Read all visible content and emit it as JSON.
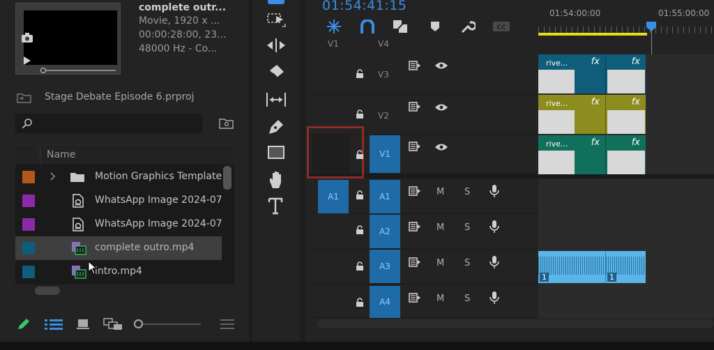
{
  "preview": {
    "name": "complete outr...",
    "line1": "Movie, 1920 x ...",
    "line2": "00:00:28:00, 23...",
    "line3": "48000 Hz - Co..."
  },
  "project": {
    "name": "Stage Debate Episode 6.prproj",
    "search_placeholder": "",
    "column_name": "Name",
    "items": [
      {
        "label": "Motion Graphics Template",
        "color": "#b5561c",
        "type": "folder"
      },
      {
        "label": "WhatsApp Image 2024-07",
        "color": "#8b2aa8",
        "type": "image"
      },
      {
        "label": "WhatsApp Image 2024-07",
        "color": "#8b2aa8",
        "type": "image"
      },
      {
        "label": "complete outro.mp4",
        "color": "#0e5d7a",
        "type": "video"
      },
      {
        "label": "intro.mp4",
        "color": "#0e5d7a",
        "type": "video"
      }
    ]
  },
  "timeline": {
    "timecode": "01:54:41:15",
    "ruler": [
      "01:54:00:00",
      "01:55:00:00"
    ],
    "src_v": "V1",
    "src_v4": "V4",
    "video_tracks": [
      {
        "label": "V3",
        "src": ""
      },
      {
        "label": "V2",
        "src": ""
      },
      {
        "label": "V1",
        "src": "V1"
      }
    ],
    "audio_tracks": [
      {
        "label": "A1",
        "src": "A1"
      },
      {
        "label": "A2",
        "src": ""
      },
      {
        "label": "A3",
        "src": ""
      },
      {
        "label": "A4",
        "src": ""
      }
    ],
    "m": "M",
    "s": "S",
    "clip_name": "rive...",
    "fx": "fx",
    "audio_clip_num": "1"
  },
  "colors": {
    "accent": "#3a8ee6",
    "v3_clip": "#0e5d7a",
    "v2_clip": "#8c8c1f",
    "v1_clip": "#11705c",
    "audio_clip": "#5ab5e8"
  }
}
